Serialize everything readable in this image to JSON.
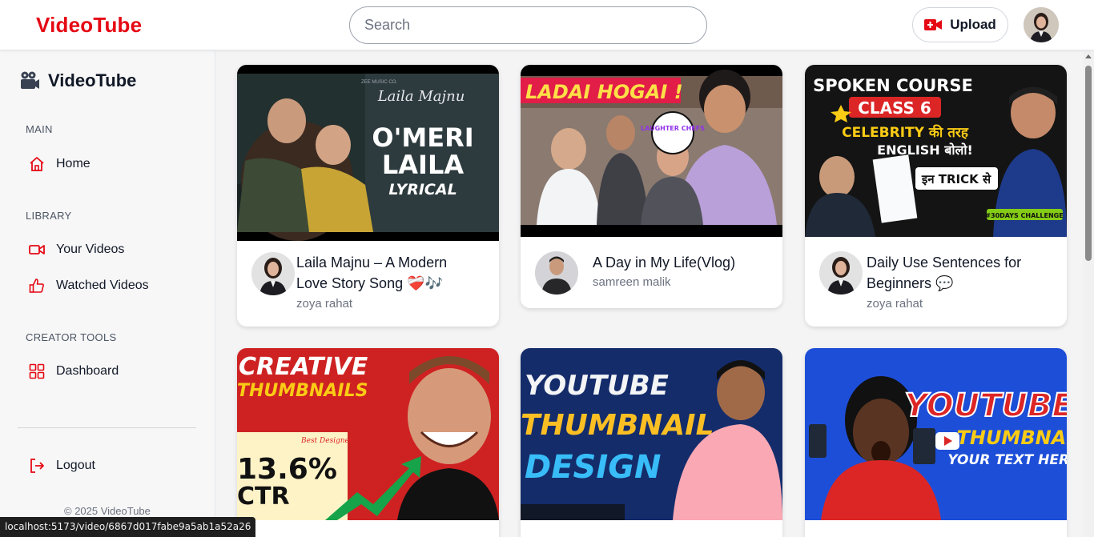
{
  "header": {
    "logo": "VideoTube",
    "search_placeholder": "Search",
    "upload_label": "Upload",
    "brand_color": "#e50914"
  },
  "sidebar": {
    "brand": "VideoTube",
    "sections": [
      {
        "title": "MAIN",
        "items": [
          {
            "label": "Home",
            "icon": "home-icon"
          }
        ]
      },
      {
        "title": "LIBRARY",
        "items": [
          {
            "label": "Your Videos",
            "icon": "video-camera-icon"
          },
          {
            "label": "Watched Videos",
            "icon": "thumbs-up-icon"
          }
        ]
      },
      {
        "title": "CREATOR TOOLS",
        "items": [
          {
            "label": "Dashboard",
            "icon": "grid-icon"
          }
        ]
      }
    ],
    "logout_label": "Logout",
    "copyright": "© 2025 VideoTube"
  },
  "videos": [
    {
      "title": "Laila Majnu – A Modern Love Story Song ❤️‍🩹🎶",
      "channel": "zoya rahat",
      "thumb_text": {
        "brand": "Laila Majnu",
        "line1": "O'MERI",
        "line2": "LAILA",
        "line3": "LYRICAL",
        "corner": "ZEE MUSIC CO."
      }
    },
    {
      "title": "A Day in My Life(Vlog)",
      "channel": "samreen malik",
      "thumb_text": {
        "headline": "LADAI HOGAI !",
        "badge": "LAUGHTER CHEFS"
      }
    },
    {
      "title": "Daily Use Sentences for Beginners 💬",
      "channel": "zoya rahat",
      "thumb_text": {
        "line1": "SPOKEN COURSE",
        "line2": "CLASS 6",
        "line3": "CELEBRITY की तरह",
        "line4": "ENGLISH बोलो!",
        "trick": "इन TRICK से",
        "challenge": "#30DAYS CHALLENGE"
      }
    },
    {
      "title": "",
      "channel": "",
      "thumb_text": {
        "line1": "CREATIVE",
        "line2": "THUMBNAILS",
        "stat": "13.6%",
        "stat2": "CTR",
        "note": "Best Designer"
      }
    },
    {
      "title": "",
      "channel": "",
      "thumb_text": {
        "line1": "YOUTUBE",
        "line2": "THUMBNAIL",
        "line3": "DESIGN"
      }
    },
    {
      "title": "",
      "channel": "",
      "thumb_text": {
        "line1": "YOUTUBE",
        "line2": "THUMBNAIL",
        "line3": "YOUR TEXT HERE"
      }
    }
  ],
  "status_url": "localhost:5173/video/6867d017fabe9a5ab1a52a26"
}
